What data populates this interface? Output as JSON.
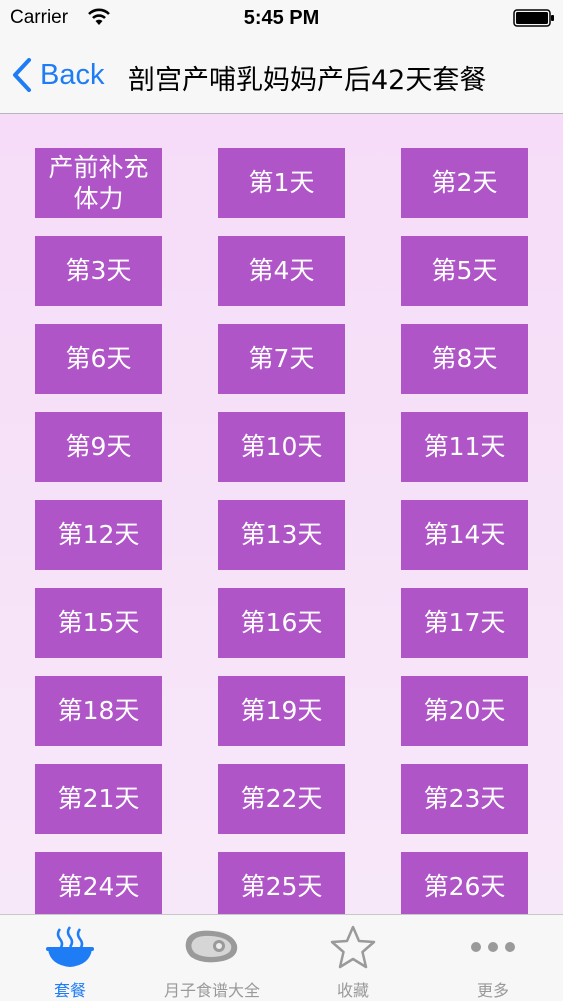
{
  "status_bar": {
    "carrier": "Carrier",
    "time": "5:45 PM"
  },
  "nav": {
    "back_label": "Back",
    "title": "剖宫产哺乳妈妈产后42天套餐"
  },
  "tiles": [
    "产前补充体力",
    "第1天",
    "第2天",
    "第3天",
    "第4天",
    "第5天",
    "第6天",
    "第7天",
    "第8天",
    "第9天",
    "第10天",
    "第11天",
    "第12天",
    "第13天",
    "第14天",
    "第15天",
    "第16天",
    "第17天",
    "第18天",
    "第19天",
    "第20天",
    "第21天",
    "第22天",
    "第23天",
    "第24天",
    "第25天",
    "第26天"
  ],
  "tabs": [
    {
      "label": "套餐",
      "icon": "bowl-icon",
      "active": true
    },
    {
      "label": "月子食谱大全",
      "icon": "meat-icon",
      "active": false
    },
    {
      "label": "收藏",
      "icon": "star-icon",
      "active": false
    },
    {
      "label": "更多",
      "icon": "more-icon",
      "active": false
    }
  ],
  "colors": {
    "accent": "#1e7cf5",
    "tile": "#af55c8",
    "background": "#f6e6f8"
  }
}
